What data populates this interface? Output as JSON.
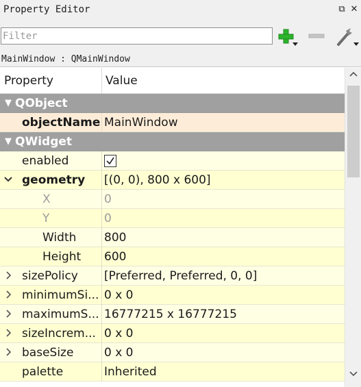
{
  "window": {
    "title": "Property Editor",
    "float_icon": "float-icon",
    "close_icon": "close-icon"
  },
  "toolbar": {
    "filter_placeholder": "Filter",
    "add_icon": "plus-icon",
    "remove_icon": "minus-icon",
    "configure_icon": "wrench-icon"
  },
  "object_line": "MainWindow : QMainWindow",
  "columns": {
    "property": "Property",
    "value": "Value"
  },
  "rows": [
    {
      "name": "QObject",
      "value": "",
      "kind": "group",
      "expander": "expanded"
    },
    {
      "name": "objectName",
      "value": "MainWindow",
      "kind": "property",
      "bold": true,
      "selected": true
    },
    {
      "name": "QWidget",
      "value": "",
      "kind": "group",
      "expander": "expanded"
    },
    {
      "name": "enabled",
      "value": "",
      "kind": "checkbox",
      "checked": true
    },
    {
      "name": "geometry",
      "value": "[(0, 0), 800 x 600]",
      "kind": "property",
      "bold": true,
      "expander": "expanded"
    },
    {
      "name": "X",
      "value": "0",
      "kind": "child",
      "disabled": true
    },
    {
      "name": "Y",
      "value": "0",
      "kind": "child",
      "disabled": true
    },
    {
      "name": "Width",
      "value": "800",
      "kind": "child"
    },
    {
      "name": "Height",
      "value": "600",
      "kind": "child"
    },
    {
      "name": "sizePolicy",
      "value": "[Preferred, Preferred, 0, 0]",
      "kind": "property",
      "expander": "collapsed"
    },
    {
      "name": "minimumSi...",
      "value": "0 x 0",
      "kind": "property",
      "expander": "collapsed"
    },
    {
      "name": "maximumS...",
      "value": "16777215 x 16777215",
      "kind": "property",
      "expander": "collapsed"
    },
    {
      "name": "sizeIncrem...",
      "value": "0 x 0",
      "kind": "property",
      "expander": "collapsed"
    },
    {
      "name": "baseSize",
      "value": "0 x 0",
      "kind": "property",
      "expander": "collapsed"
    },
    {
      "name": "palette",
      "value": "Inherited",
      "kind": "property"
    }
  ],
  "colors": {
    "group_bg": "#a0a0a0",
    "selected_bg": "#fdecd8",
    "row_bg_light": "#ffffe4",
    "row_bg_dark": "#ffffd2",
    "disabled_text": "#9c9c9c",
    "add_icon": "#2db32d"
  }
}
